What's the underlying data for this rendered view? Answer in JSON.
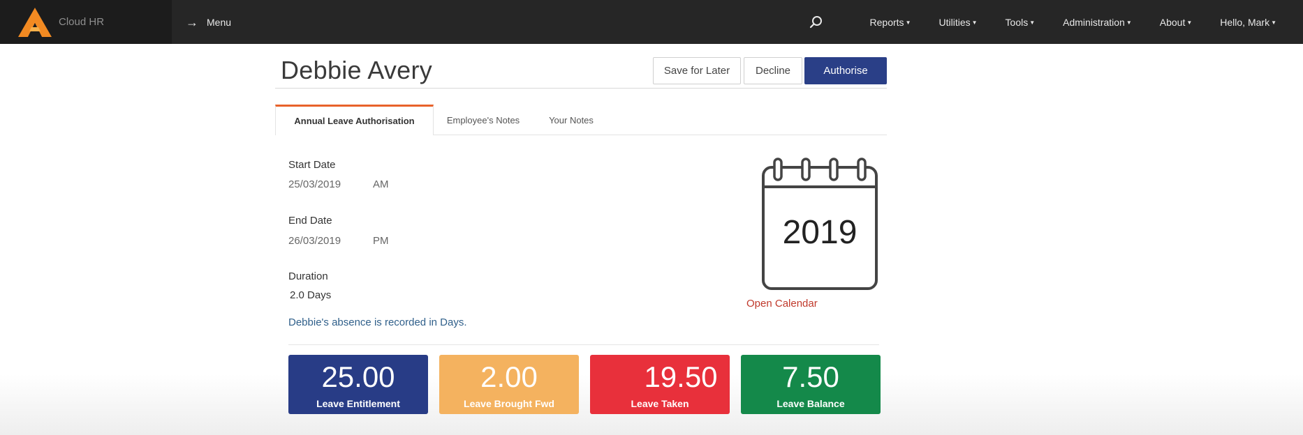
{
  "app": {
    "name": "Cloud HR",
    "menu_label": "Menu"
  },
  "nav": {
    "items": [
      "Reports",
      "Utilities",
      "Tools",
      "Administration",
      "About",
      "Hello, Mark"
    ]
  },
  "employee": {
    "name": "Debbie Avery"
  },
  "actions": {
    "save_later": "Save for Later",
    "decline": "Decline",
    "authorise": "Authorise"
  },
  "tabs": [
    {
      "label": "Annual Leave Authorisation",
      "active": true
    },
    {
      "label": "Employee's Notes",
      "active": false
    },
    {
      "label": "Your Notes",
      "active": false
    }
  ],
  "leave": {
    "start_label": "Start Date",
    "start_date": "25/03/2019",
    "start_half": "AM",
    "end_label": "End Date",
    "end_date": "26/03/2019",
    "end_half": "PM",
    "duration_label": "Duration",
    "duration": "2.0 Days",
    "unit_note": "Debbie's absence is recorded in Days."
  },
  "calendar": {
    "year": "2019",
    "link": "Open Calendar"
  },
  "stats": [
    {
      "value": "25.00",
      "label": "Leave Entitlement",
      "color": "#283c86"
    },
    {
      "value": "2.00",
      "label": "Leave Brought Fwd",
      "color": "#f4b25f"
    },
    {
      "value": "19.50",
      "label": "Leave Taken",
      "color": "#e8303b"
    },
    {
      "value": "7.50",
      "label": "Leave Balance",
      "color": "#14894a"
    }
  ],
  "theme": {
    "navbar": "#262626",
    "accent": "#e8622a",
    "primary_button": "#2a3f87",
    "link": "#c0392b"
  },
  "icons": {
    "logo": "orange-a-logo",
    "menu": "arrow-right-icon",
    "search": "search-icon",
    "calendar": "calendar-icon"
  }
}
